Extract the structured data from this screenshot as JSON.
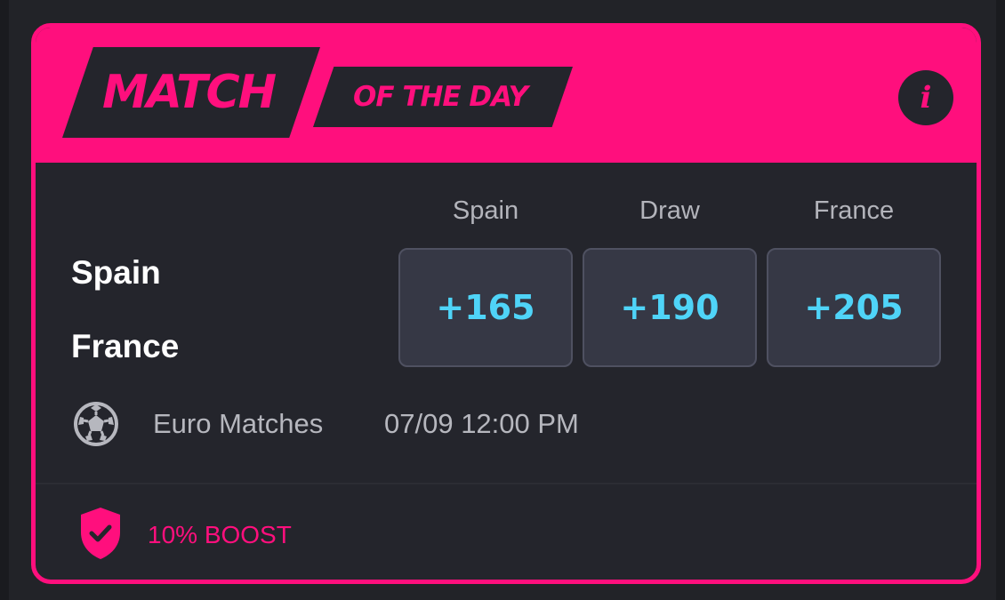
{
  "header": {
    "title_main": "MATCH",
    "title_sub": "OF THE DAY",
    "info_label": "i"
  },
  "match": {
    "home_team": "Spain",
    "away_team": "France",
    "odds": [
      {
        "label": "Spain",
        "value": "+165"
      },
      {
        "label": "Draw",
        "value": "+190"
      },
      {
        "label": "France",
        "value": "+205"
      }
    ],
    "league": "Euro Matches",
    "datetime": "07/09 12:00 PM",
    "league_icon": "soccer-ball-icon"
  },
  "footer": {
    "boost_label": "10% BOOST",
    "boost_icon": "shield-check-icon"
  },
  "colors": {
    "accent": "#ff0f7d",
    "odds": "#4fd4f8",
    "background": "#24252c"
  }
}
